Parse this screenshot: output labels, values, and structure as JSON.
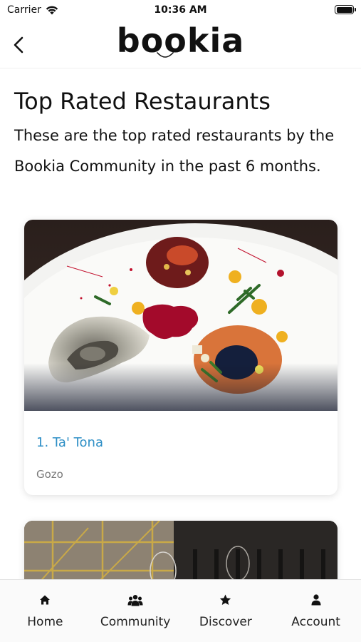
{
  "status": {
    "carrier": "Carrier",
    "time": "10:36 AM"
  },
  "header": {
    "logo": "bookia",
    "back_icon": "chevron-left-icon"
  },
  "page": {
    "title": "Top Rated Restaurants",
    "description": "These are the top rated restaurants by the Bookia Community in the past 6 months."
  },
  "restaurants": [
    {
      "name": "1. Ta' Tona",
      "location": "Gozo",
      "image": "food-plate-photo"
    },
    {
      "image": "restaurant-interior-photo"
    }
  ],
  "tabs": [
    {
      "label": "Home",
      "icon": "home-icon"
    },
    {
      "label": "Community",
      "icon": "community-icon"
    },
    {
      "label": "Discover",
      "icon": "star-icon"
    },
    {
      "label": "Account",
      "icon": "account-icon"
    }
  ],
  "colors": {
    "accent": "#2e8fc6",
    "location": "#777777",
    "tab_bar": "#fafafa"
  }
}
